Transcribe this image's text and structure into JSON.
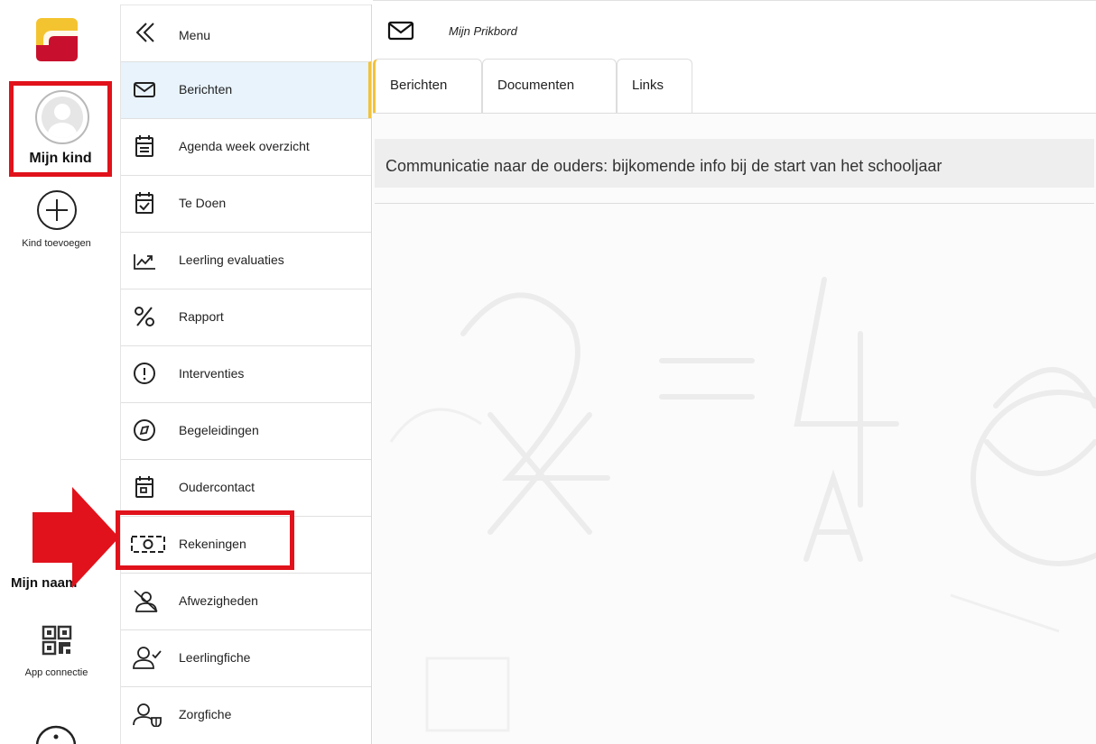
{
  "rail": {
    "child_name": "Mijn kind",
    "add_child_label": "Kind toevoegen",
    "my_name": "Mijn naam",
    "app_connection_label": "App connectie"
  },
  "menu": {
    "header_label": "Menu",
    "items": [
      {
        "label": "Berichten",
        "icon": "envelope-icon",
        "active": true
      },
      {
        "label": "Agenda week overzicht",
        "icon": "calendar-list-icon"
      },
      {
        "label": "Te Doen",
        "icon": "calendar-check-icon"
      },
      {
        "label": "Leerling evaluaties",
        "icon": "chart-trend-icon"
      },
      {
        "label": "Rapport",
        "icon": "percent-icon"
      },
      {
        "label": "Interventies",
        "icon": "exclamation-circle-icon"
      },
      {
        "label": "Begeleidingen",
        "icon": "compass-icon"
      },
      {
        "label": "Oudercontact",
        "icon": "calendar-day-icon"
      },
      {
        "label": "Rekeningen",
        "icon": "banknote-icon"
      },
      {
        "label": "Afwezigheden",
        "icon": "user-slash-icon"
      },
      {
        "label": "Leerlingfiche",
        "icon": "user-check-icon"
      },
      {
        "label": "Zorgfiche",
        "icon": "user-shield-icon"
      }
    ]
  },
  "main": {
    "title": "Mijn Prikbord",
    "tabs": [
      {
        "label": "Berichten",
        "active": true
      },
      {
        "label": "Documenten"
      },
      {
        "label": "Links"
      }
    ],
    "notice": "Communicatie naar de ouders: bijkomende info bij de start van het schooljaar"
  },
  "colors": {
    "highlight_red": "#e1121b",
    "active_accent": "#f2c23a",
    "active_bg": "#e8f3fc"
  }
}
